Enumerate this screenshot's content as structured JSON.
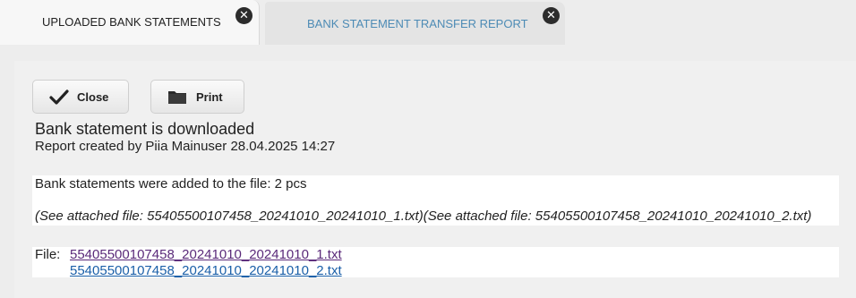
{
  "tabs": [
    {
      "label": "UPLOADED BANK STATEMENTS",
      "active": false
    },
    {
      "label": "BANK STATEMENT TRANSFER REPORT",
      "active": true
    }
  ],
  "tab_close_glyph": "✕",
  "toolbar": {
    "close_label": "Close",
    "close_icon": "checkmark-icon",
    "print_label": "Print",
    "print_icon": "folder-icon"
  },
  "report": {
    "title": "Bank statement is downloaded",
    "created_by": "Report created by Piia Mainuser 28.04.2025 14:27",
    "added_text": "Bank statements were added to the file: 2 pcs",
    "attached_text": "(See attached file: 55405500107458_20241010_20241010_1.txt)(See attached file: 55405500107458_20241010_20241010_2.txt)",
    "file_label": "File:",
    "files": [
      "55405500107458_20241010_20241010_1.txt",
      "55405500107458_20241010_20241010_2.txt"
    ]
  },
  "colors": {
    "active_tab_text": "#4d8bb5",
    "visited_link": "#5a2a7a",
    "link": "#1a5fa8"
  }
}
